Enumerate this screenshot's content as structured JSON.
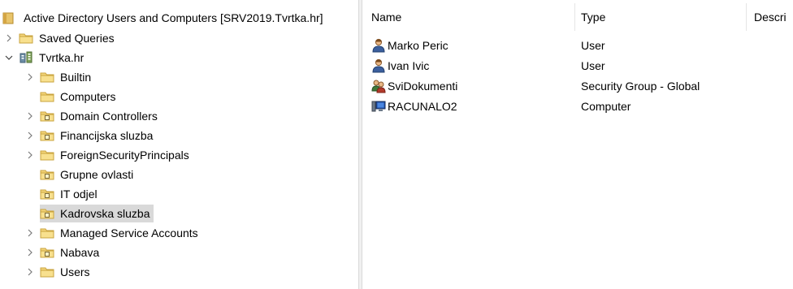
{
  "tree": {
    "root_label": "Active Directory Users and Computers [SRV2019.Tvrtka.hr]",
    "items": [
      {
        "label": "Saved Queries",
        "expander": "collapsed",
        "icon": "folder-icon"
      },
      {
        "label": "Tvrtka.hr",
        "expander": "expanded",
        "icon": "domain-icon"
      },
      {
        "label": "Builtin",
        "expander": "collapsed",
        "icon": "folder-icon"
      },
      {
        "label": "Computers",
        "expander": "none",
        "icon": "folder-icon"
      },
      {
        "label": "Domain Controllers",
        "expander": "collapsed",
        "icon": "ou-folder-icon"
      },
      {
        "label": "Financijska sluzba",
        "expander": "collapsed",
        "icon": "ou-folder-icon"
      },
      {
        "label": "ForeignSecurityPrincipals",
        "expander": "collapsed",
        "icon": "folder-icon"
      },
      {
        "label": "Grupne ovlasti",
        "expander": "none",
        "icon": "ou-folder-icon"
      },
      {
        "label": "IT odjel",
        "expander": "none",
        "icon": "ou-folder-icon"
      },
      {
        "label": "Kadrovska sluzba",
        "expander": "none",
        "icon": "ou-folder-icon",
        "selected": true
      },
      {
        "label": "Managed Service Accounts",
        "expander": "collapsed",
        "icon": "folder-icon"
      },
      {
        "label": "Nabava",
        "expander": "collapsed",
        "icon": "ou-folder-icon"
      },
      {
        "label": "Users",
        "expander": "collapsed",
        "icon": "folder-icon"
      }
    ]
  },
  "list": {
    "columns": [
      "Name",
      "Type",
      "Descri"
    ],
    "rows": [
      {
        "name": "Marko Peric",
        "type": "User",
        "icon": "user-icon"
      },
      {
        "name": "Ivan Ivic",
        "type": "User",
        "icon": "user-icon"
      },
      {
        "name": "SviDokumenti",
        "type": "Security Group - Global",
        "icon": "group-icon"
      },
      {
        "name": "RACUNALO2",
        "type": "Computer",
        "icon": "computer-icon"
      }
    ]
  }
}
